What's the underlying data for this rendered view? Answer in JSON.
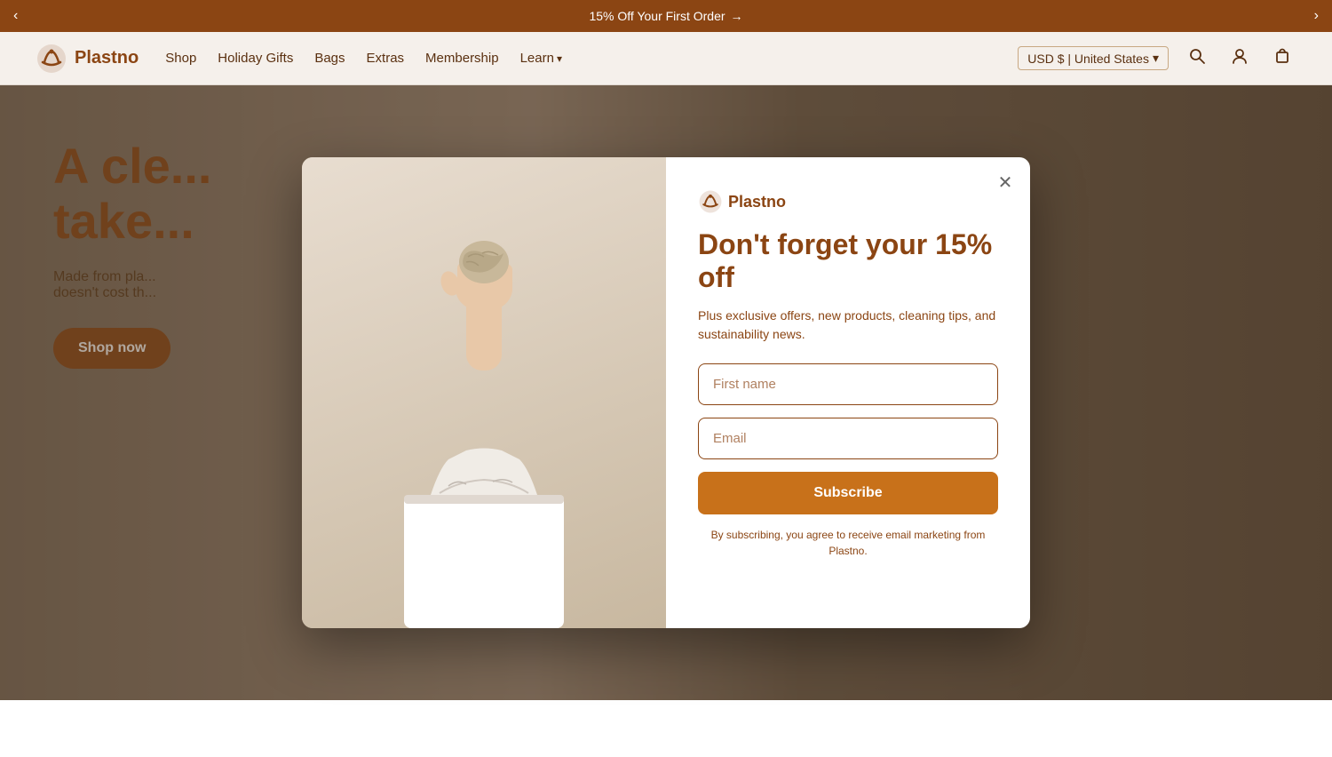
{
  "announcement": {
    "text": "15% Off Your First Order",
    "arrow": "→",
    "prev_arrow": "‹",
    "next_arrow": "›"
  },
  "header": {
    "logo_text": "Plastno",
    "nav_items": [
      {
        "label": "Shop",
        "id": "shop",
        "has_dropdown": false
      },
      {
        "label": "Holiday Gifts",
        "id": "holiday-gifts",
        "has_dropdown": false
      },
      {
        "label": "Bags",
        "id": "bags",
        "has_dropdown": false
      },
      {
        "label": "Extras",
        "id": "extras",
        "has_dropdown": false
      },
      {
        "label": "Membership",
        "id": "membership",
        "has_dropdown": false
      },
      {
        "label": "Learn",
        "id": "learn",
        "has_dropdown": true
      }
    ],
    "currency": "USD $ | United States"
  },
  "hero": {
    "heading_line1": "A cle",
    "heading_line2": "take",
    "subtext_line1": "Made from pla",
    "subtext_line2": "doesn't cost th",
    "shop_now_label": "Shop now"
  },
  "modal": {
    "logo_text": "Plastno",
    "heading": "Don't forget your 15% off",
    "subtext": "Plus exclusive offers, new products, cleaning tips, and sustainability news.",
    "first_name_placeholder": "First name",
    "email_placeholder": "Email",
    "subscribe_label": "Subscribe",
    "disclaimer": "By subscribing, you agree to receive email marketing from Plastno."
  }
}
